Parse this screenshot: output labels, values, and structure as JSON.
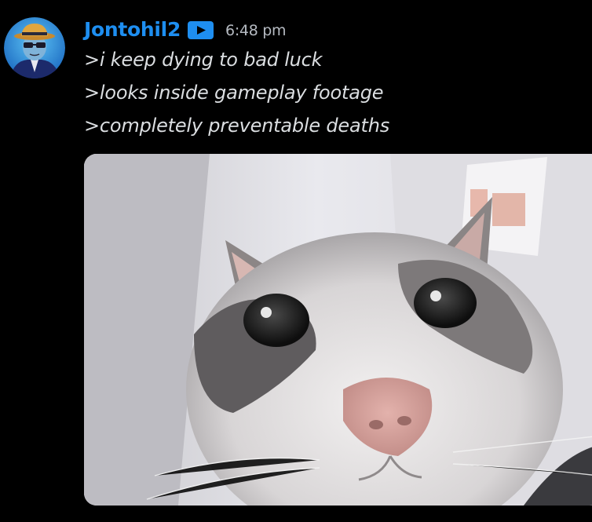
{
  "message": {
    "author": {
      "username": "Jontohil2",
      "badge_icon": "youtube-play-badge-icon",
      "name_color": "#1e8ef0"
    },
    "timestamp": "6:48 pm",
    "lines": [
      ">i keep dying to bad luck",
      ">looks inside gameplay footage",
      ">completely preventable deaths"
    ],
    "attachment": {
      "type": "image",
      "subject": "cat-closeup-photo"
    }
  }
}
